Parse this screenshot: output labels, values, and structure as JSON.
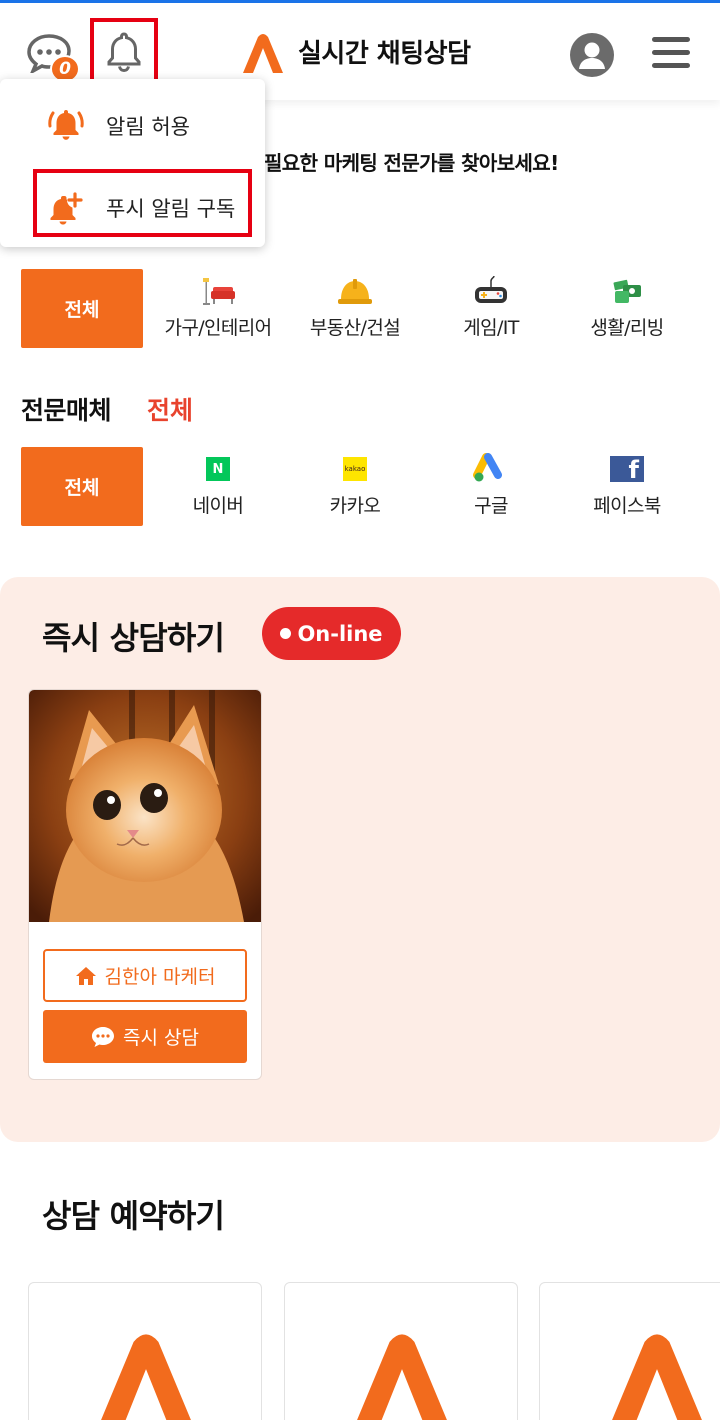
{
  "header": {
    "chat_badge_count": "0",
    "site_title": "실시간 채팅상담",
    "icons": [
      "chat-icon",
      "bell-icon",
      "logo-icon",
      "user-icon",
      "hamburger-icon"
    ]
  },
  "notification_menu": {
    "items": [
      {
        "label": "알림 허용",
        "icon": "bell-ring-icon"
      },
      {
        "label": "푸시 알림 구독",
        "icon": "bell-plus-icon"
      }
    ]
  },
  "headline": "필요한 마케팅 전문가를 찾아보세요!",
  "categories": {
    "all_label": "전체",
    "items": [
      {
        "label": "가구/인테리어",
        "icon": "furniture-icon"
      },
      {
        "label": "부동산/건설",
        "icon": "helmet-icon"
      },
      {
        "label": "게임/IT",
        "icon": "gamepad-icon"
      },
      {
        "label": "생활/리빙",
        "icon": "living-icon"
      }
    ]
  },
  "media": {
    "title": "전문매체",
    "all_link": "전체",
    "all_label": "전체",
    "items": [
      {
        "label": "네이버",
        "icon": "naver-icon",
        "glyph": "N"
      },
      {
        "label": "카카오",
        "icon": "kakao-icon",
        "glyph": "kakao"
      },
      {
        "label": "구글",
        "icon": "google-ads-icon"
      },
      {
        "label": "페이스북",
        "icon": "facebook-icon",
        "glyph": "f"
      }
    ]
  },
  "instant": {
    "title": "즉시 상담하기",
    "status": "On-line",
    "card": {
      "marketer_label": "김한아 마케터",
      "consult_label": "즉시 상담"
    }
  },
  "reserve": {
    "title": "상담 예약하기"
  },
  "colors": {
    "accent": "#f26b1d",
    "highlight_box": "#e60012",
    "online_badge": "#e52a2a",
    "section_bg": "#fdede6"
  }
}
